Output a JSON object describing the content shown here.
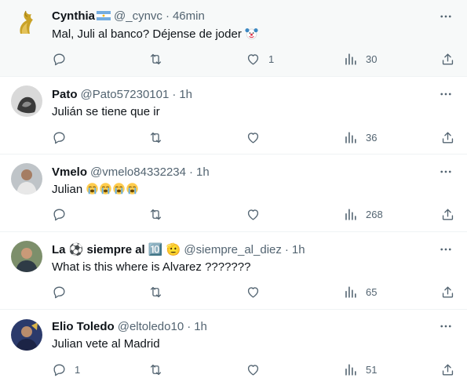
{
  "replies": [
    {
      "name": "Cynthia",
      "handle": "@_cynvc",
      "separator": "·",
      "time": "46min",
      "text": "Mal, Juli al banco? Déjense de joder",
      "text_emoji": "clown-face",
      "name_badge": "argentina-flag",
      "counts": {
        "replies": "",
        "retweets": "",
        "likes": "1",
        "views": "30"
      },
      "avatar_icon": "gold-horse-logo",
      "highlighted": true
    },
    {
      "name": "Pato",
      "handle": "@Pato57230101",
      "separator": "·",
      "time": "1h",
      "text": "Julián se tiene que ir",
      "counts": {
        "replies": "",
        "retweets": "",
        "likes": "",
        "views": "36"
      },
      "avatar_icon": "user-photo-avatar"
    },
    {
      "name": "Vmelo",
      "handle": "@vmelo84332234",
      "separator": "·",
      "time": "1h",
      "text": "Julian",
      "text_emoji": "loudly-crying-face x4",
      "counts": {
        "replies": "",
        "retweets": "",
        "likes": "",
        "views": "268"
      },
      "avatar_icon": "user-photo-avatar"
    },
    {
      "name": "La ⚽ siempre al 🔟 🫡",
      "handle": "@siempre_al_diez",
      "separator": "·",
      "time": "1h",
      "text": "What is this where is Alvarez ???????",
      "counts": {
        "replies": "",
        "retweets": "",
        "likes": "",
        "views": "65"
      },
      "avatar_icon": "user-photo-avatar"
    },
    {
      "name": "Elio Toledo",
      "handle": "@eltoledo10",
      "separator": "·",
      "time": "1h",
      "text": "Julian vete al Madrid",
      "counts": {
        "replies": "1",
        "retweets": "",
        "likes": "",
        "views": "51"
      },
      "avatar_icon": "user-photo-avatar"
    }
  ],
  "colors": {
    "text": "#0f1419",
    "muted": "#536471",
    "divider": "#eff3f4",
    "highlight_bg": "#f7f9f9"
  },
  "icons": [
    "more-icon",
    "reply-icon",
    "retweet-icon",
    "like-icon",
    "views-icon",
    "share-icon"
  ]
}
